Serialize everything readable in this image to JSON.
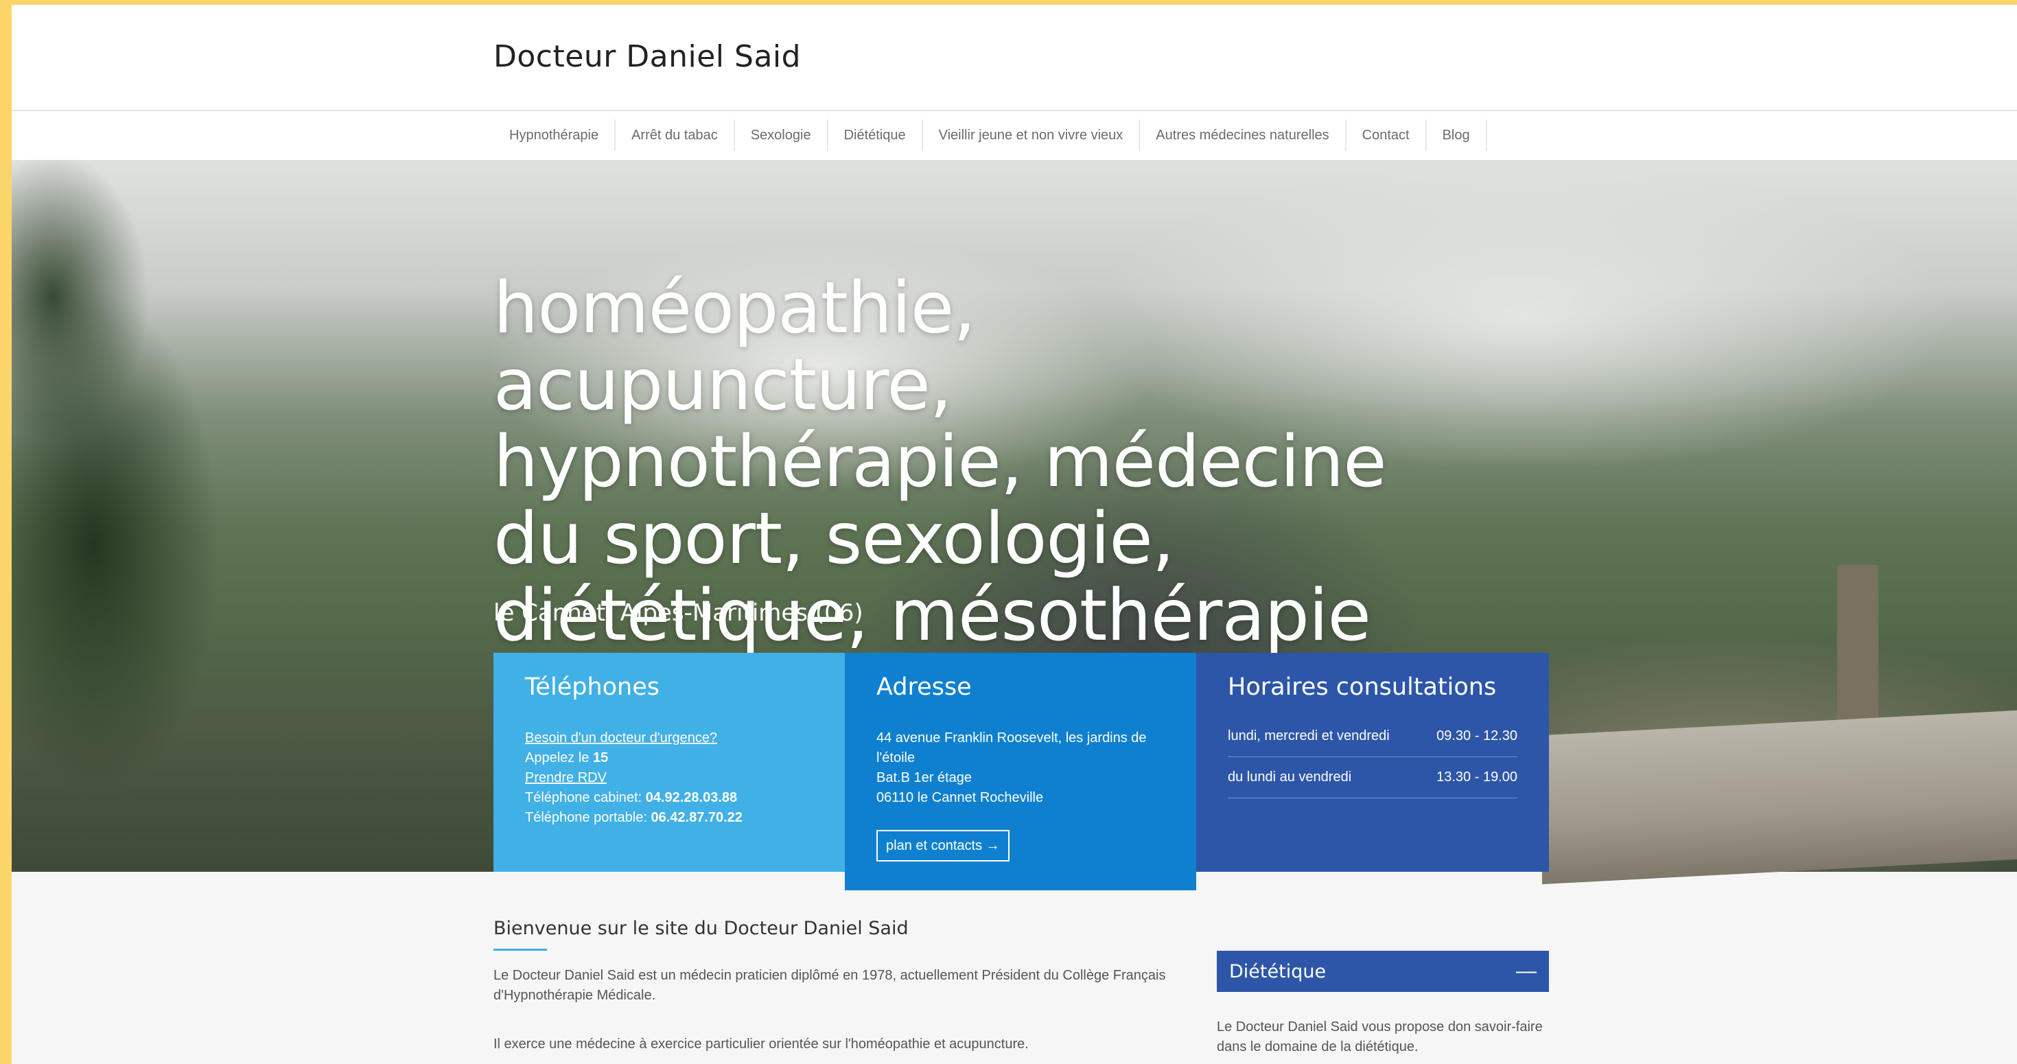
{
  "site": {
    "title": "Docteur Daniel Said"
  },
  "nav": {
    "items": [
      "Hypnothérapie",
      "Arrêt du tabac",
      "Sexologie",
      "Diététique",
      "Vieillir jeune et non vivre vieux",
      "Autres médecines naturelles",
      "Contact",
      "Blog"
    ]
  },
  "hero": {
    "title": "homéopathie, acupuncture, hypnothérapie, médecine du sport, sexologie, diététique, mésothérapie",
    "subtitle": "le Cannet, Alpes-Maritimes (06)"
  },
  "phones": {
    "heading": "Téléphones",
    "urgency_link": "Besoin d'un docteur d'urgence?",
    "call_prefix": "Appelez le ",
    "call_number": "15",
    "rdv_link": "Prendre RDV",
    "cabinet_label": "Téléphone cabinet: ",
    "cabinet_number": "04.92.28.03.88",
    "mobile_label": "Téléphone portable: ",
    "mobile_number": "06.42.87.70.22"
  },
  "address": {
    "heading": "Adresse",
    "line1": "44 avenue Franklin Roosevelt, les jardins de l'étoile",
    "line2": "Bat.B 1er étage",
    "line3": "06110 le Cannet Rocheville",
    "button": "plan et contacts →"
  },
  "hours": {
    "heading": "Horaires consultations",
    "rows": [
      {
        "days": "lundi, mercredi et vendredi",
        "time": "09.30 - 12.30"
      },
      {
        "days": "du lundi au vendredi",
        "time": "13.30 - 19.00"
      }
    ]
  },
  "welcome": {
    "title": "Bienvenue sur le site du Docteur Daniel Said",
    "para1": "Le Docteur Daniel Said est un médecin praticien diplômé en 1978, actuellement Président du Collège Français d'Hypnothérapie Médicale.",
    "para2": "Il exerce une médecine à exercice particulier orientée sur l'homéopathie et acupuncture."
  },
  "widget": {
    "title": "Diététique",
    "toggle": "—",
    "text": "Le Docteur Daniel Said vous propose don savoir-faire dans le domaine de la diététique."
  },
  "colors": {
    "light_blue": "#41b0e6",
    "mid_blue": "#0f80cf",
    "dark_blue": "#2d56a8",
    "frame_yellow": "#fcd56a"
  }
}
